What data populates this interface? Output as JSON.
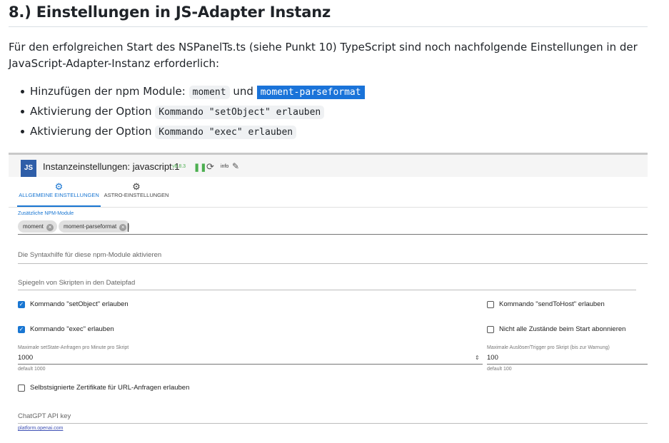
{
  "doc": {
    "heading": "8.) Einstellungen in JS-Adapter Instanz",
    "paragraph": "Für den erfolgreichen Start des NSPanelTs.ts (siehe Punkt 10) TypeScript sind noch nachfolgende Einstellungen in der JavaScript-Adapter-Instanz erforderlich:",
    "items": [
      {
        "text": "Hinzufügen der npm Module:",
        "code1": "moment",
        "joiner": "und",
        "code2": "moment-parseformat"
      },
      {
        "text": "Aktivierung der Option",
        "code1": "Kommando \"setObject\" erlauben"
      },
      {
        "text": "Aktivierung der Option",
        "code1": "Kommando \"exec\" erlauben"
      }
    ]
  },
  "shot": {
    "logo": "JS",
    "title": "Instanzeinstellungen: javascript.1",
    "version": "v8.8.3",
    "info": "info",
    "tabs": [
      "ALLGEMEINE EINSTELLUNGEN",
      "ASTRO-EINSTELLUNGEN"
    ],
    "npm_label": "Zusätzliche NPM-Module",
    "chips": [
      "moment",
      "moment-parseformat"
    ],
    "syntax_placeholder": "Die Syntaxhilfe für diese npm-Module aktivieren",
    "mirror_placeholder": "Spiegeln von Skripten in den Dateipfad",
    "checkboxes": {
      "setobject": {
        "label": "Kommando \"setObject\" erlauben",
        "checked": true
      },
      "exec": {
        "label": "Kommando \"exec\" erlauben",
        "checked": true
      },
      "sendtohost": {
        "label": "Kommando \"sendToHost\" erlauben",
        "checked": false
      },
      "subscribe": {
        "label": "Nicht alle Zustände beim Start abonnieren",
        "checked": false
      },
      "selfsigned": {
        "label": "Selbstsignierte Zertifikate für URL-Anfragen erlauben",
        "checked": false
      }
    },
    "max_setstate": {
      "label": "Maximale setState-Anfragen pro Minute pro Skript",
      "value": "1000",
      "help": "default 1000"
    },
    "max_triggers": {
      "label": "Maximale Auslöser/Trigger pro Skript (bis zur Warnung)",
      "value": "100",
      "help": "default 100"
    },
    "chatgpt_placeholder": "ChatGPT API key",
    "chatgpt_link": "platform.openai.com"
  }
}
